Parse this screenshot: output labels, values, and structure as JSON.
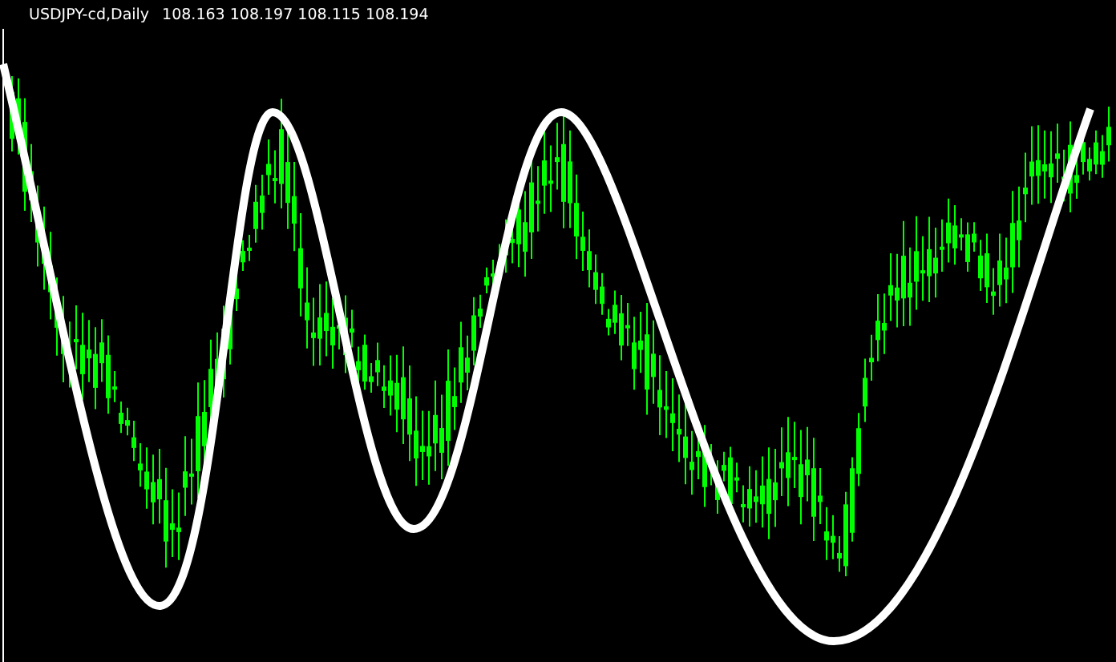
{
  "chart": {
    "symbol": "USDJPY-cd,Daily",
    "quotes": [
      "108.163",
      "108.197",
      "108.115",
      "108.194"
    ]
  }
}
